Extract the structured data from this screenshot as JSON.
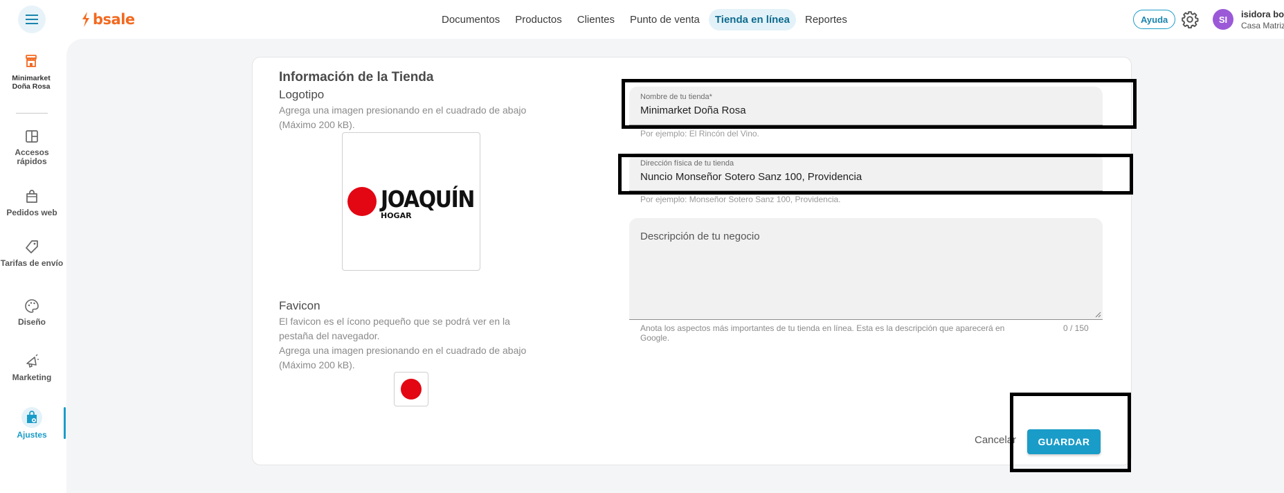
{
  "header": {
    "brand": "bsale",
    "nav": [
      {
        "label": "Documentos",
        "active": false
      },
      {
        "label": "Productos",
        "active": false
      },
      {
        "label": "Clientes",
        "active": false
      },
      {
        "label": "Punto de venta",
        "active": false
      },
      {
        "label": "Tienda en línea",
        "active": true
      },
      {
        "label": "Reportes",
        "active": false
      }
    ],
    "help_label": "Ayuda",
    "user": {
      "initials": "SI",
      "name": "isidora bob",
      "branch": "Casa Matriz"
    }
  },
  "sidebar": {
    "store_name": "Minimarket Doña Rosa",
    "items": [
      {
        "label": "Accesos rápidos",
        "icon": "grid-icon"
      },
      {
        "label": "Pedidos web",
        "icon": "shopping-bag-icon"
      },
      {
        "label": "Tarifas de envío",
        "icon": "tag-icon"
      },
      {
        "label": "Diseño",
        "icon": "palette-icon"
      },
      {
        "label": "Marketing",
        "icon": "megaphone-icon"
      },
      {
        "label": "Ajustes",
        "icon": "settings-bag-icon",
        "active": true
      }
    ]
  },
  "form": {
    "section_title": "Información de la Tienda",
    "logo": {
      "title": "Logotipo",
      "help": "Agrega una imagen presionando en el cuadrado de abajo (Máximo 200 kB).",
      "brand_name": "JOAQUÍN",
      "brand_sub": "HOGAR"
    },
    "favicon": {
      "title": "Favicon",
      "help_1": "El favicon es el ícono pequeño que se podrá ver en la pestaña del navegador.",
      "help_2": "Agrega una imagen presionando en el cuadrado de abajo (Máximo 200 kB)."
    },
    "store_name_field": {
      "label": "Nombre de tu tienda*",
      "value": "Minimarket Doña Rosa",
      "hint": "Por ejemplo: El Rincón del Vino."
    },
    "address_field": {
      "label": "Dirección física de tu tienda",
      "value": "Nuncio Monseñor Sotero Sanz 100, Providencia",
      "hint": "Por ejemplo: Monseñor Sotero Sanz 100, Providencia."
    },
    "description_field": {
      "placeholder": "Descripción de tu negocio",
      "hint": "Anota los aspectos más importantes de tu tienda en línea. Esta es la descripción que aparecerá en Google.",
      "counter": "0 / 150"
    },
    "cancel_label": "Cancelar",
    "save_label": "GUARDAR"
  },
  "colors": {
    "brand": "#f26a21",
    "accent": "#1a9cc8",
    "logo_red": "#e30613"
  }
}
